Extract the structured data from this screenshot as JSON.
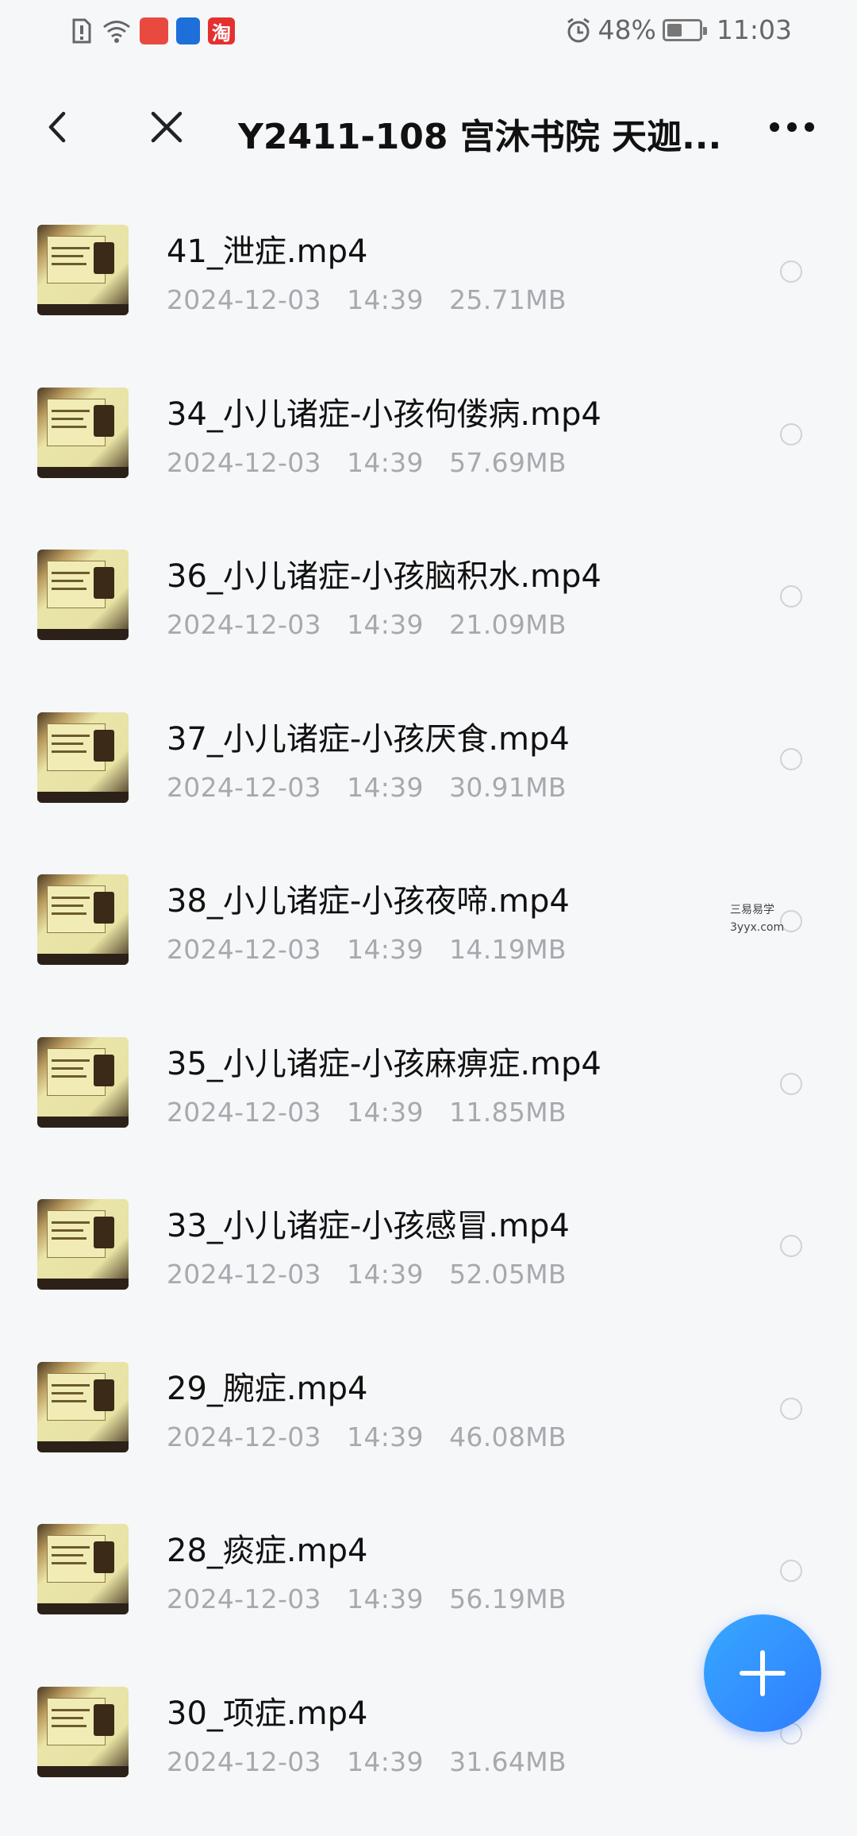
{
  "status_bar": {
    "battery_percent": "48%",
    "time": "11:03",
    "battery_level": 0.48
  },
  "header": {
    "title": "Y2411-108 宫沐书院 天迦..."
  },
  "files": [
    {
      "name": "41_泄症.mp4",
      "date": "2024-12-03",
      "time": "14:39",
      "size": "25.71MB"
    },
    {
      "name": "34_小儿诸症-小孩佝偻病.mp4",
      "date": "2024-12-03",
      "time": "14:39",
      "size": "57.69MB"
    },
    {
      "name": "36_小儿诸症-小孩脑积水.mp4",
      "date": "2024-12-03",
      "time": "14:39",
      "size": "21.09MB"
    },
    {
      "name": "37_小儿诸症-小孩厌食.mp4",
      "date": "2024-12-03",
      "time": "14:39",
      "size": "30.91MB"
    },
    {
      "name": "38_小儿诸症-小孩夜啼.mp4",
      "date": "2024-12-03",
      "time": "14:39",
      "size": "14.19MB"
    },
    {
      "name": "35_小儿诸症-小孩麻痹症.mp4",
      "date": "2024-12-03",
      "time": "14:39",
      "size": "11.85MB"
    },
    {
      "name": "33_小儿诸症-小孩感冒.mp4",
      "date": "2024-12-03",
      "time": "14:39",
      "size": "52.05MB"
    },
    {
      "name": "29_腕症.mp4",
      "date": "2024-12-03",
      "time": "14:39",
      "size": "46.08MB"
    },
    {
      "name": "28_痰症.mp4",
      "date": "2024-12-03",
      "time": "14:39",
      "size": "56.19MB"
    },
    {
      "name": "30_项症.mp4",
      "date": "2024-12-03",
      "time": "14:39",
      "size": "31.64MB"
    }
  ],
  "watermark": {
    "line1": "三易易学",
    "line2": "3yyx.com"
  },
  "colors": {
    "fab": "#2f8cff",
    "meta_text": "#a6a9ae"
  }
}
